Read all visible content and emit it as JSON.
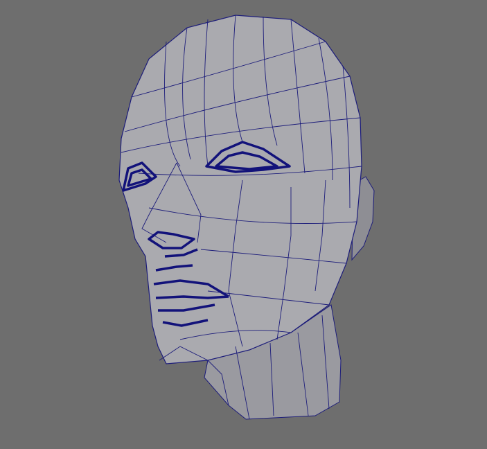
{
  "viewport": {
    "model": "head-mesh",
    "colors": {
      "background": "#6e6e6e",
      "surface": "#a9a9ae",
      "surface_shadow": "#8a8a90",
      "wire": "#1c1c7a",
      "edge_loop": "#12127a"
    }
  }
}
